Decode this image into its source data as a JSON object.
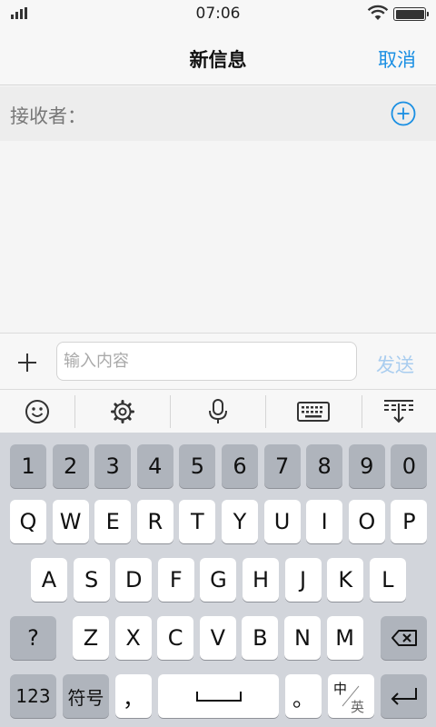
{
  "status_bar": {
    "time": "07:06"
  },
  "nav": {
    "title": "新信息",
    "cancel": "取消"
  },
  "recipient": {
    "label": "接收者："
  },
  "compose": {
    "placeholder": "输入内容",
    "send": "发送"
  },
  "toolbar": [
    "emoji-icon",
    "gear-icon",
    "microphone-icon",
    "keyboard-icon",
    "keyboard-hide-icon"
  ],
  "keyboard": {
    "number_row": [
      "1",
      "2",
      "3",
      "4",
      "5",
      "6",
      "7",
      "8",
      "9",
      "0"
    ],
    "row1": [
      "Q",
      "W",
      "E",
      "R",
      "T",
      "Y",
      "U",
      "I",
      "O",
      "P"
    ],
    "row2": [
      "A",
      "S",
      "D",
      "F",
      "G",
      "H",
      "J",
      "K",
      "L"
    ],
    "row3": [
      "?",
      "Z",
      "X",
      "C",
      "V",
      "B",
      "N",
      "M"
    ],
    "bottom": {
      "numbers": "123",
      "symbols": "符号",
      "comma": "，",
      "period": "。",
      "lang_top": "中",
      "lang_bottom": "英"
    }
  },
  "colors": {
    "accent": "#1a8fe3",
    "send_disabled": "#a9cdef",
    "keyboard_bg": "#d2d5db",
    "func_key": "#afb4bc"
  }
}
